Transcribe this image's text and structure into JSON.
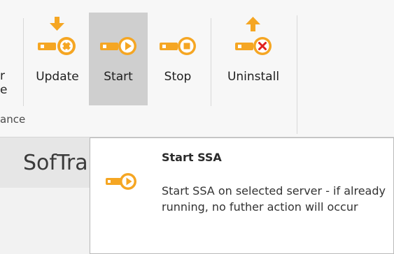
{
  "ribbon": {
    "cut_label_line1": "r",
    "cut_label_line2": "e",
    "group_label": "ance",
    "buttons": [
      {
        "label": "Update",
        "icon": "key-gear-icon"
      },
      {
        "label": "Start",
        "icon": "key-play-icon"
      },
      {
        "label": "Stop",
        "icon": "key-stop-icon"
      },
      {
        "label": "Uninstall",
        "icon": "key-remove-icon"
      }
    ]
  },
  "lower": {
    "partial_title": "SofTra"
  },
  "tooltip": {
    "title": "Start SSA",
    "description": "Start SSA on selected server - if already running, no futher action will occur",
    "icon": "key-play-icon"
  },
  "colors": {
    "accent_orange": "#F5A623",
    "remove_red": "#E02020",
    "pressed_bg": "#CFCFCF"
  }
}
